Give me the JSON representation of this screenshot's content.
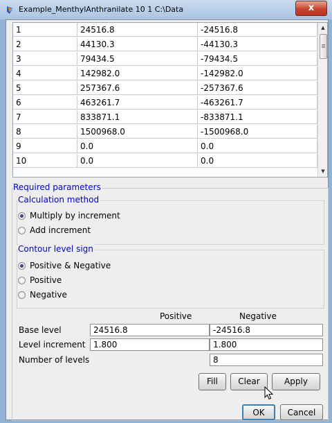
{
  "window": {
    "title": "Example_MenthylAnthranilate  10  1  C:\\Data",
    "close_label": "x",
    "app_icon": "java-app-icon"
  },
  "table": {
    "rows": [
      {
        "index": "1",
        "positive": "24516.8",
        "negative": "-24516.8"
      },
      {
        "index": "2",
        "positive": "44130.3",
        "negative": "-44130.3"
      },
      {
        "index": "3",
        "positive": "79434.5",
        "negative": "-79434.5"
      },
      {
        "index": "4",
        "positive": "142982.0",
        "negative": "-142982.0"
      },
      {
        "index": "5",
        "positive": "257367.6",
        "negative": "-257367.6"
      },
      {
        "index": "6",
        "positive": "463261.7",
        "negative": "-463261.7"
      },
      {
        "index": "7",
        "positive": "833871.1",
        "negative": "-833871.1"
      },
      {
        "index": "8",
        "positive": "1500968.0",
        "negative": "-1500968.0"
      },
      {
        "index": "9",
        "positive": "0.0",
        "negative": "0.0"
      },
      {
        "index": "10",
        "positive": "0.0",
        "negative": "0.0"
      }
    ]
  },
  "params": {
    "section_title": "Required parameters",
    "calc_method": {
      "title": "Calculation method",
      "options": [
        {
          "label": "Multiply by increment",
          "selected": true
        },
        {
          "label": "Add increment",
          "selected": false
        }
      ]
    },
    "sign": {
      "title": "Contour level sign",
      "options": [
        {
          "label": "Positive & Negative",
          "selected": true
        },
        {
          "label": "Positive",
          "selected": false
        },
        {
          "label": "Negative",
          "selected": false
        }
      ]
    },
    "grid": {
      "positive_header": "Positive",
      "negative_header": "Negative",
      "base_level_label": "Base level",
      "base_level_positive": "24516.8",
      "base_level_negative": "-24516.8",
      "level_increment_label": "Level increment",
      "level_increment_positive": "1.800",
      "level_increment_negative": "1.800",
      "number_of_levels_label": "Number of levels",
      "number_of_levels": "8"
    },
    "buttons": {
      "fill": "Fill",
      "clear": "Clear",
      "apply": "Apply"
    }
  },
  "footer": {
    "ok": "OK",
    "cancel": "Cancel"
  }
}
